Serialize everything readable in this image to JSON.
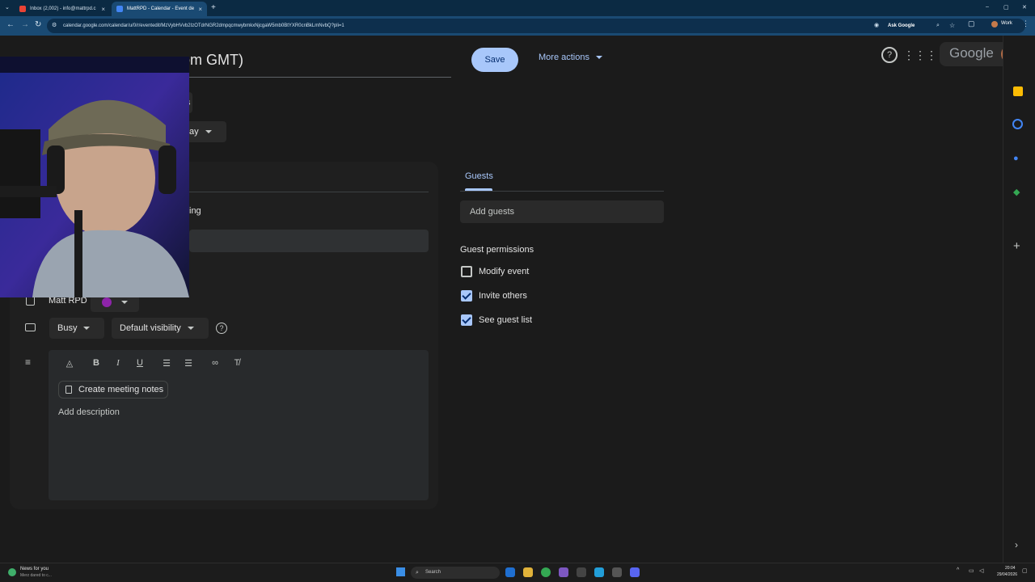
{
  "browser": {
    "tabs": [
      {
        "title": "Inbox (2,002) - info@mattrpd.c",
        "close": "×"
      },
      {
        "title": "MattRPD - Calendar - Event de",
        "close": "×"
      }
    ],
    "new_tab": "+",
    "url": "calendar.google.com/calendar/u/0/r/eventedit/MzVybHVvb2IzOTdrNGR2dmpqcmwybmkxNjcgaW5mb0BtYXR0cnBkLmNvbQ?pli=1",
    "ask_google": "Ask Google",
    "profile": "Work",
    "window_controls": [
      "–",
      "▢",
      "✕"
    ]
  },
  "header": {
    "title_partial": "om GMT)",
    "save_label": "Save",
    "more_actions_label": "More actions"
  },
  "account": {
    "google_label": "Google"
  },
  "left": {
    "partial_chip": "s",
    "partial_select": "ay",
    "partial_meeting": "ing",
    "calendar_owner": "Matt RPD",
    "calendar_color": "#8e24aa",
    "busy_label": "Busy",
    "visibility_label": "Default visibility",
    "meeting_notes_label": "Create meeting notes",
    "description_placeholder": "Add description"
  },
  "guests": {
    "tab_label": "Guests",
    "add_guests_placeholder": "Add guests",
    "permissions_title": "Guest permissions",
    "permissions": [
      {
        "label": "Modify event",
        "checked": false
      },
      {
        "label": "Invite others",
        "checked": true
      },
      {
        "label": "See guest list",
        "checked": true
      }
    ]
  },
  "taskbar": {
    "news_title": "News for you",
    "news_sub": "Merz dared to c...",
    "search_label": "Search",
    "time": "20:04",
    "date": "29/04/2026"
  },
  "colors": {
    "accent": "#a8c7fa",
    "background": "#1b1b1b"
  }
}
